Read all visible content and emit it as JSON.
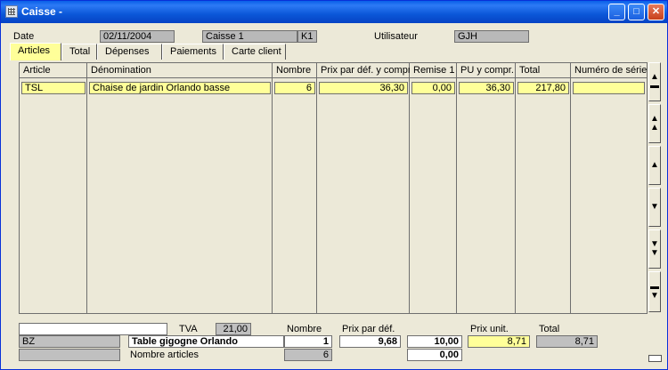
{
  "window": {
    "title": "Caisse -"
  },
  "header": {
    "date_label": "Date",
    "date_value": "02/11/2004",
    "caisse_value": "Caisse 1",
    "caisse_code": "K1",
    "user_label": "Utilisateur",
    "user_value": "GJH"
  },
  "tabs": [
    {
      "label": "Articles"
    },
    {
      "label": "Total"
    },
    {
      "label": "Dépenses"
    },
    {
      "label": "Paiements"
    },
    {
      "label": "Carte client"
    }
  ],
  "grid": {
    "headers": [
      "Article",
      "Dénomination",
      "Nombre",
      "Prix par déf. y compr.",
      "Remise 1",
      "PU y compr.",
      "Total",
      "Numéro de série"
    ],
    "rows": [
      [
        "TSL",
        "Chaise de jardin Orlando basse",
        "6",
        "36,30",
        "0,00",
        "36,30",
        "217,80",
        ""
      ]
    ]
  },
  "scroll_buttons": [
    "scroll-first-icon",
    "scroll-page-up-icon",
    "scroll-up-icon",
    "scroll-down-icon",
    "scroll-page-down-icon",
    "scroll-last-icon"
  ],
  "footer": {
    "tva_label": "TVA",
    "tva_value": "21,00",
    "nombre_label": "Nombre",
    "prix_def_label": "Prix par déf.",
    "prix_unit_label": "Prix unit.",
    "total_label": "Total",
    "article_code": "BZ",
    "article_name": "Table gigogne Orlando",
    "nombre_value": "1",
    "prix_def_value": "9,68",
    "amount_value": "10,00",
    "prix_unit_value": "8,71",
    "total_value": "8,71",
    "nombre_articles_label": "Nombre articles",
    "nombre_articles_value": "6",
    "second_amount_value": "0,00",
    "top_input_value": ""
  }
}
